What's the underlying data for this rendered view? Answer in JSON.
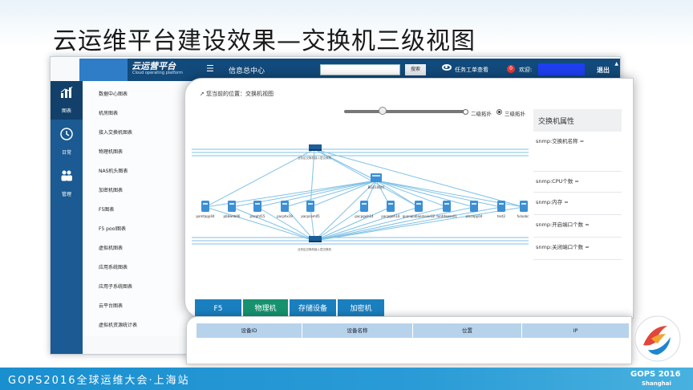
{
  "slide": {
    "title": "云运维平台建设效果—交换机三级视图"
  },
  "app": {
    "logo_text": "云运营平台",
    "logo_sub": "Cloud operating platform",
    "info_center": "信息总中心",
    "search_button": "搜索",
    "task_link": "任务工单查看",
    "notif_count": "0",
    "welcome": "欢迎:",
    "logout": "退出"
  },
  "sidebar": {
    "tabs": [
      {
        "label": "图表",
        "icon": "bar-chart-icon"
      },
      {
        "label": "日常",
        "icon": "clock-icon"
      },
      {
        "label": "管理",
        "icon": "users-icon"
      }
    ],
    "items": [
      "数据中心图表",
      "机房图表",
      "接入交换机图表",
      "物理机图表",
      "NAS机头图表",
      "加密机图表",
      "F5图表",
      "F5 pool图表",
      "虚拟机图表",
      "应用系统图表",
      "应用子系统图表",
      "云平台图表",
      "虚拟机资源统计表"
    ]
  },
  "panel": {
    "breadcrumb": "您当前的位置：交换机视图",
    "radio_level2": "二级拓扑",
    "radio_level3": "三级拓扑",
    "slider_value": 0.32
  },
  "topology": {
    "top_switch_label": "",
    "top_switch_caption": "业务区交换机接入层交换机",
    "center_switch_label": "BG0100(f)",
    "bottom_switch_caption": "业务区交换机接入层交换机",
    "servers": [
      "pamtapp04",
      "pbbweb06",
      "pacpht15",
      "pacphx19",
      "pacpcom05",
      "pacpgwh14",
      "pacpgwh16",
      "quanqiubaomeier02",
      "tontdapas01",
      "placepp04",
      "test2",
      "fulaabcs"
    ]
  },
  "properties": {
    "title": "交换机属性",
    "rows": [
      "snmp:交换机名称 =",
      "snmp:CPU个数 =",
      "snmp:内存 =",
      "snmp:开启端口个数 =",
      "snmp:关闭端口个数 ="
    ]
  },
  "tabs": [
    {
      "label": "F5",
      "color": "#1a7fbf"
    },
    {
      "label": "物理机",
      "color": "#16926e"
    },
    {
      "label": "存储设备",
      "color": "#1a7fbf"
    },
    {
      "label": "加密机",
      "color": "#1a7fbf"
    }
  ],
  "table": {
    "headers": [
      "设备ID",
      "设备名称",
      "位置",
      "IP"
    ]
  },
  "footer": {
    "text": "GOPS2016全球运维大会·上海站",
    "logo_label": "GOPS 2016",
    "logo_city": "Shanghai"
  }
}
